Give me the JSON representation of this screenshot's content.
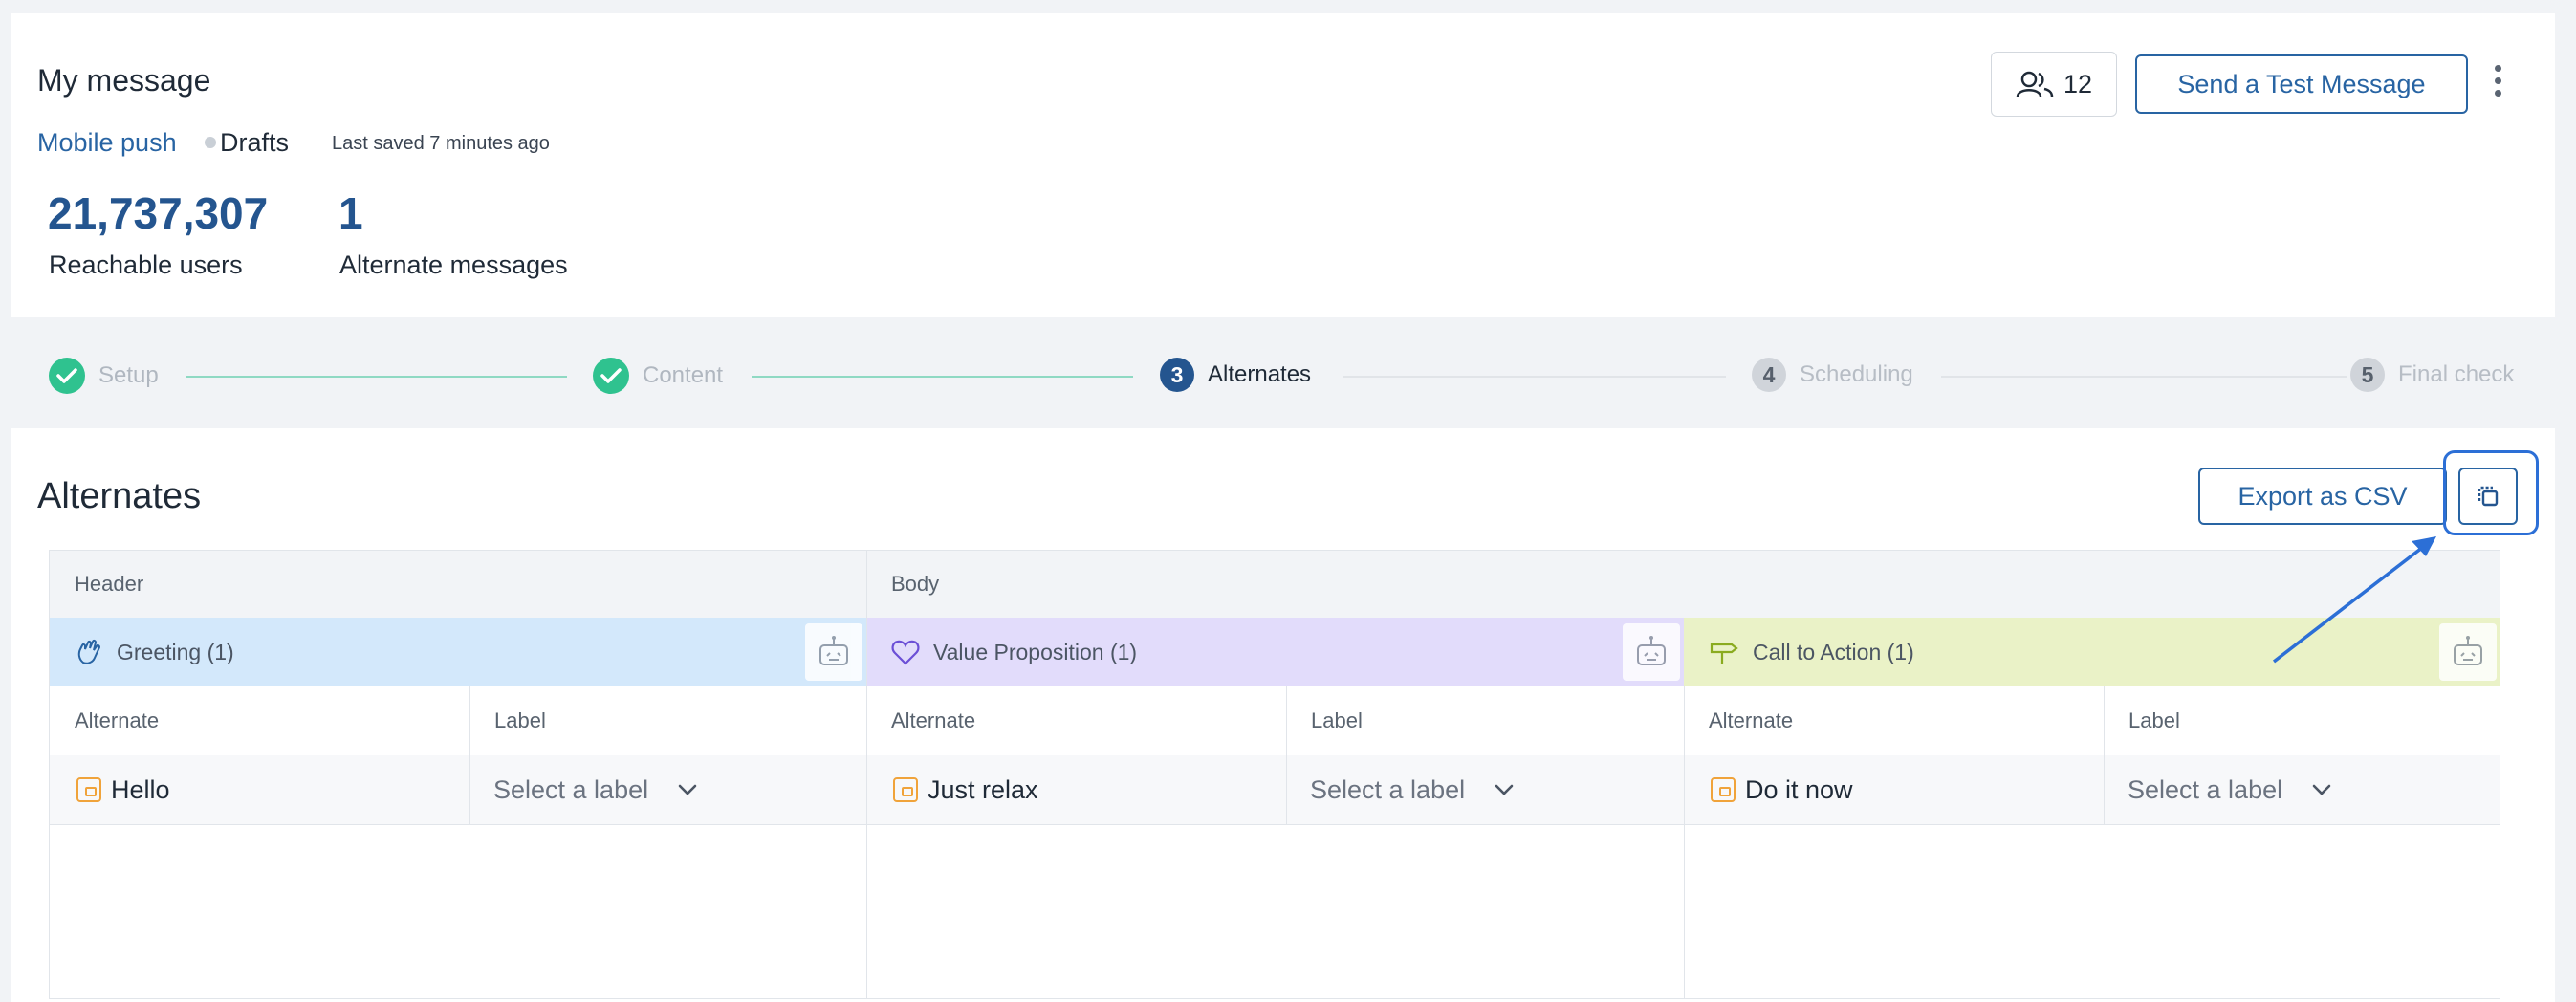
{
  "header": {
    "title": "My message",
    "channel": "Mobile push",
    "status": "Drafts",
    "last_saved": "Last saved 7 minutes ago",
    "audience_count": "12",
    "send_test_label": "Send a Test Message",
    "stats": [
      {
        "value": "21,737,307",
        "label": "Reachable users"
      },
      {
        "value": "1",
        "label": "Alternate messages"
      }
    ]
  },
  "stepper": {
    "steps": [
      {
        "label": "Setup",
        "state": "done"
      },
      {
        "label": "Content",
        "state": "done"
      },
      {
        "number": "3",
        "label": "Alternates",
        "state": "active"
      },
      {
        "number": "4",
        "label": "Scheduling",
        "state": "todo"
      },
      {
        "number": "5",
        "label": "Final check",
        "state": "todo"
      }
    ]
  },
  "alternates": {
    "title": "Alternates",
    "export_label": "Export as CSV",
    "copy_icon": "copy-icon",
    "table": {
      "columns": [
        "Header",
        "Body"
      ],
      "groups": [
        {
          "name": "Greeting (1)",
          "icon": "wave-hand-icon",
          "color": "#d3e8fb"
        },
        {
          "name": "Value Proposition (1)",
          "icon": "heart-icon",
          "color": "#e2dcfb"
        },
        {
          "name": "Call to Action (1)",
          "icon": "signpost-icon",
          "color": "#eaf2c7"
        }
      ],
      "sub_headers": [
        "Alternate",
        "Label"
      ],
      "rows": [
        {
          "alternates": [
            "Hello",
            "Just relax",
            "Do it now"
          ],
          "label_placeholder": "Select a label"
        }
      ]
    }
  },
  "colors": {
    "accent": "#2864a3",
    "success": "#2fc28f",
    "highlight": "#2c6fd6"
  }
}
